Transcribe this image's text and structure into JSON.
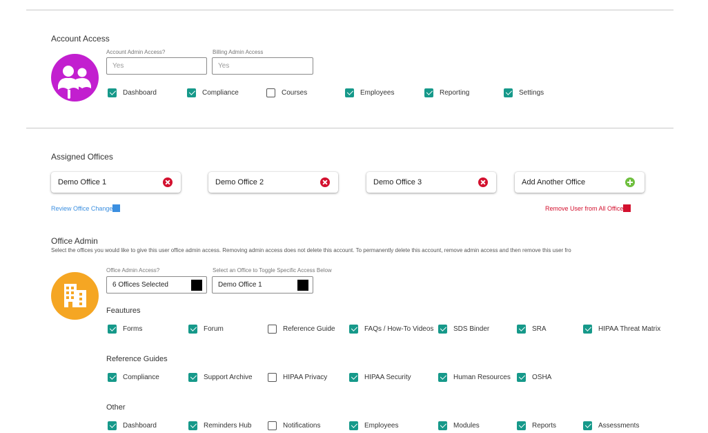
{
  "account_access": {
    "title": "Account Access",
    "account_admin": {
      "label": "Account Admin Access?",
      "value": "Yes"
    },
    "billing_admin": {
      "label": "Billing Admin Access",
      "value": "Yes"
    },
    "permissions": [
      {
        "label": "Dashboard",
        "checked": true
      },
      {
        "label": "Compliance",
        "checked": true
      },
      {
        "label": "Courses",
        "checked": false
      },
      {
        "label": "Employees",
        "checked": true
      },
      {
        "label": "Reporting",
        "checked": true
      },
      {
        "label": "Settings",
        "checked": true
      }
    ],
    "avatar_color": "#c21fcf"
  },
  "assigned_offices": {
    "title": "Assigned Offices",
    "offices": [
      "Demo Office 1",
      "Demo Office 2",
      "Demo Office 3"
    ],
    "add_label": "Add Another Office",
    "review_link": "Review Office Change",
    "remove_link": "Remove User from All Office"
  },
  "office_admin": {
    "title": "Office Admin",
    "description": "Select the offices you would like to give this user office admin access.  Removing admin access does not delete this account.  To permanently delete this account, remove admin access and then remove this user fro",
    "admin_access": {
      "label": "Office Admin Access?",
      "value": "6 Offices Selected"
    },
    "office_select": {
      "label": "Select an Office to Toggle Specific Access Below",
      "value": "Demo Office 1"
    },
    "icon_color": "#f5a623",
    "groups": [
      {
        "title": "Feautures",
        "items": [
          {
            "label": "Forms",
            "checked": true
          },
          {
            "label": "Forum",
            "checked": true
          },
          {
            "label": "Reference Guide",
            "checked": false
          },
          {
            "label": "FAQs / How-To Videos",
            "checked": true
          },
          {
            "label": "SDS Binder",
            "checked": true
          },
          {
            "label": "SRA",
            "checked": true
          },
          {
            "label": "HIPAA Threat Matrix",
            "checked": true
          }
        ]
      },
      {
        "title": "Reference Guides",
        "items": [
          {
            "label": "Compliance",
            "checked": true
          },
          {
            "label": "Support Archive",
            "checked": true
          },
          {
            "label": "HIPAA Privacy",
            "checked": false
          },
          {
            "label": "HIPAA Security",
            "checked": true
          },
          {
            "label": "Human Resources",
            "checked": true
          },
          {
            "label": "OSHA",
            "checked": true
          }
        ]
      },
      {
        "title": "Other",
        "items": [
          {
            "label": "Dashboard",
            "checked": true
          },
          {
            "label": "Reminders Hub",
            "checked": true
          },
          {
            "label": "Notifications",
            "checked": false
          },
          {
            "label": "Employees",
            "checked": true
          },
          {
            "label": "Modules",
            "checked": true
          },
          {
            "label": "Reports",
            "checked": true
          },
          {
            "label": "Assessments",
            "checked": true
          }
        ]
      }
    ]
  },
  "colors": {
    "checkbox_accent": "#16998a",
    "remove_red": "#d3102e",
    "link_blue": "#3b8fe0",
    "add_green": "#6fbf3f"
  }
}
